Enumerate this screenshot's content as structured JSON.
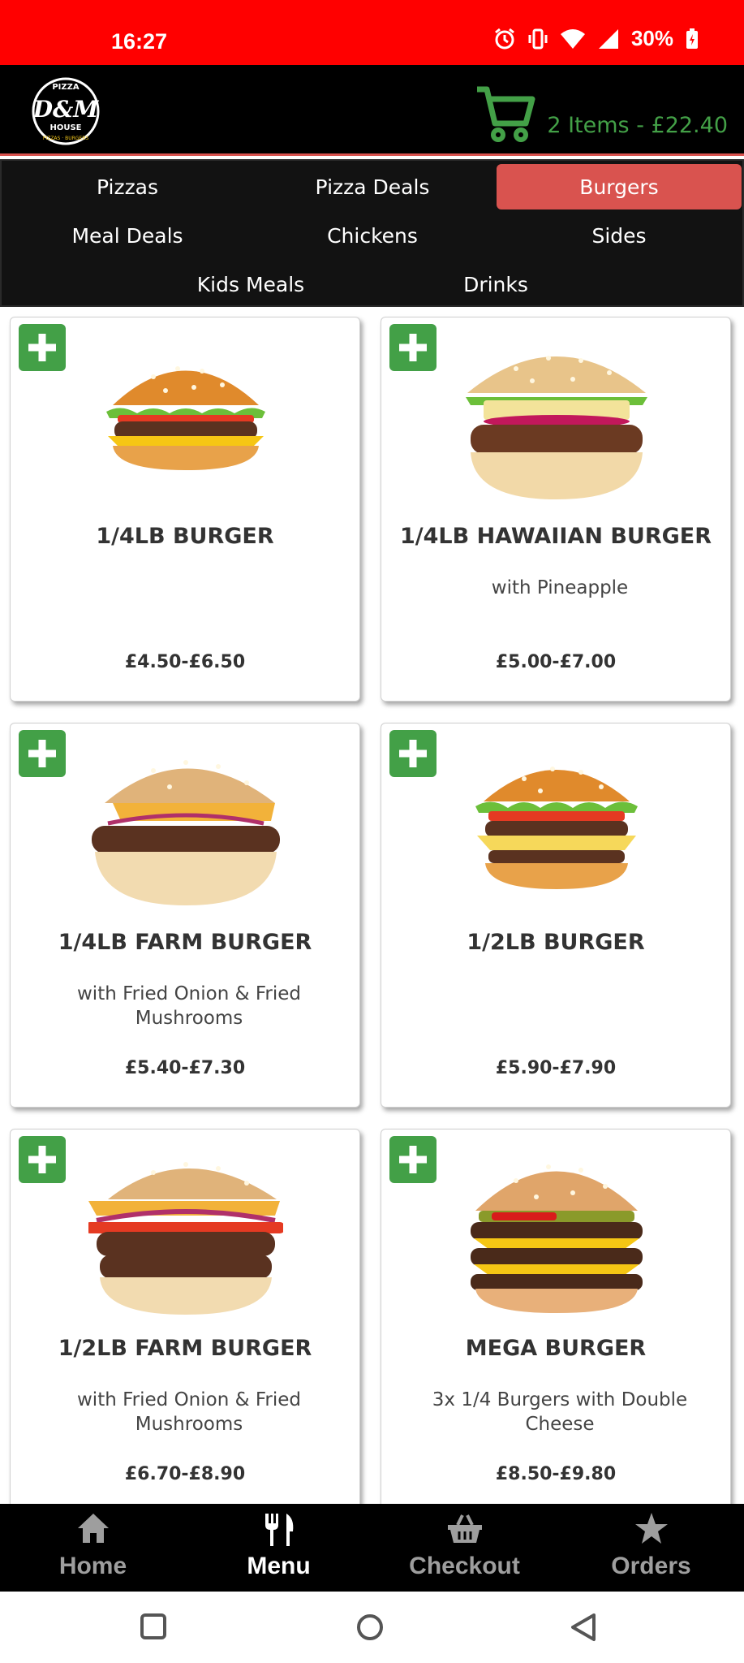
{
  "status_bar": {
    "time": "16:27",
    "battery": "30%"
  },
  "header": {
    "logo_text": [
      "PIZZA",
      "D&M",
      "HOUSE",
      "PIZZAS · BURGERS"
    ],
    "cart_summary": "2 Items - £22.40"
  },
  "tabs": [
    "Pizzas",
    "Pizza Deals",
    "Burgers",
    "Meal Deals",
    "Chickens",
    "Sides",
    "Kids Meals",
    "Drinks"
  ],
  "active_tab": "Burgers",
  "products": [
    {
      "title": "1/4LB BURGER",
      "desc": "",
      "price": "£4.50-£6.50"
    },
    {
      "title": "1/4LB HAWAIIAN BURGER",
      "desc": "with Pineapple",
      "price": "£5.00-£7.00"
    },
    {
      "title": "1/4LB FARM BURGER",
      "desc": "with Fried Onion & Fried Mushrooms",
      "price": "£5.40-£7.30"
    },
    {
      "title": "1/2LB BURGER",
      "desc": "",
      "price": "£5.90-£7.90"
    },
    {
      "title": "1/2LB FARM BURGER",
      "desc": "with Fried Onion & Fried Mushrooms",
      "price": "£6.70-£8.90"
    },
    {
      "title": "MEGA BURGER",
      "desc": "3x 1/4 Burgers with Double Cheese",
      "price": "£8.50-£9.80"
    }
  ],
  "bottom_nav": [
    {
      "label": "Home",
      "icon": "home-icon"
    },
    {
      "label": "Menu",
      "icon": "utensils-icon"
    },
    {
      "label": "Checkout",
      "icon": "basket-icon"
    },
    {
      "label": "Orders",
      "icon": "star-icon"
    }
  ],
  "active_nav": "Menu",
  "colors": {
    "status_bar": "#ff0000",
    "accent_red": "#d9534f",
    "accent_green": "#43a047",
    "tabs_bg": "#121212"
  }
}
